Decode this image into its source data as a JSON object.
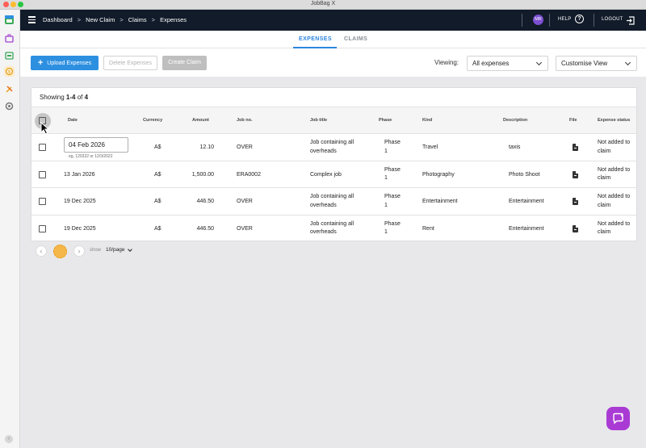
{
  "window": {
    "title": "JobBag X"
  },
  "breadcrumb": [
    "Dashboard",
    "New Claim",
    "Claims",
    "Expenses"
  ],
  "breadcrumb_separator": ">",
  "header": {
    "avatar_initials": "MR",
    "help_label": "HELP",
    "logout_label": "LOGOUT"
  },
  "tabs": [
    {
      "label": "EXPENSES",
      "active": true
    },
    {
      "label": "CLAIMS",
      "active": false
    }
  ],
  "toolbar": {
    "upload_label": "Upload Expenses",
    "delete_label": "Delete Expenses",
    "create_label": "Create Claim",
    "viewing_label": "Viewing:",
    "viewing_value": "All expenses",
    "customise_value": "Customise View"
  },
  "summary": {
    "showing_prefix": "Showing",
    "range": "1-4",
    "of_label": "of",
    "total": "4"
  },
  "table": {
    "columns": [
      "Date",
      "Currency",
      "Amount",
      "Job no.",
      "Job title",
      "Phase",
      "Kind",
      "Description",
      "File",
      "Expense status"
    ],
    "rows": [
      {
        "date": "04 Feb 2026",
        "date_hint": "eg, 120322 or 12/3/2022",
        "currency": "A$",
        "amount": "12.10",
        "job_no": "OVER",
        "job_title_1": "Job containing all",
        "job_title_2": "overheads",
        "phase_1": "Phase",
        "phase_2": "1",
        "kind": "Travel",
        "description": "taxis",
        "status_1": "Not added to",
        "status_2": "claim"
      },
      {
        "date": "13 Jan 2026",
        "currency": "A$",
        "amount": "1,500.00",
        "job_no": "ERA0002",
        "job_title_1": "Complex job",
        "job_title_2": "",
        "phase_1": "Phase",
        "phase_2": "1",
        "kind": "Photography",
        "description": "Photo Shoot",
        "status_1": "Not added to",
        "status_2": "claim"
      },
      {
        "date": "19 Dec 2025",
        "currency": "A$",
        "amount": "446.50",
        "job_no": "OVER",
        "job_title_1": "Job containing all",
        "job_title_2": "overheads",
        "phase_1": "Phase",
        "phase_2": "1",
        "kind": "Entertainment",
        "description": "Entertainment",
        "status_1": "Not added to",
        "status_2": "claim"
      },
      {
        "date": "19 Dec 2025",
        "currency": "A$",
        "amount": "446.50",
        "job_no": "OVER",
        "job_title_1": "Job containing all",
        "job_title_2": "overheads",
        "phase_1": "Phase",
        "phase_2": "1",
        "kind": "Rent",
        "description": "Entertainment",
        "status_1": "Not added to",
        "status_2": "claim"
      }
    ]
  },
  "pagination": {
    "show_label": "show",
    "per_page": "10/page"
  },
  "colors": {
    "header_bg": "#111b29",
    "accent_blue": "#2d8fe0",
    "avatar_purple": "#7c4fd0",
    "chat_purple": "#a93bd4",
    "pager_current": "#f5b74a"
  },
  "icons": [
    "hamburger-icon",
    "help-icon",
    "logout-icon",
    "plus-icon",
    "chevron-down-icon",
    "file-icon",
    "chevron-left-icon",
    "chevron-right-icon",
    "chat-icon",
    "cursor-icon"
  ]
}
